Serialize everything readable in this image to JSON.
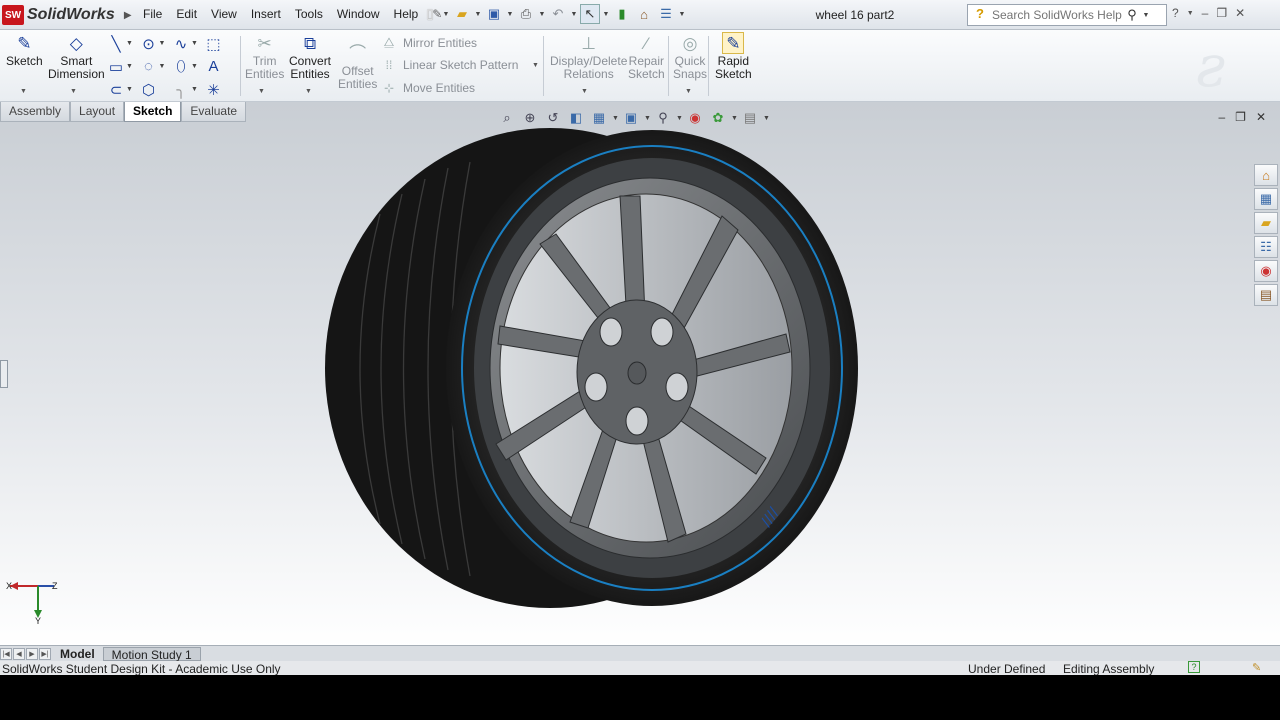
{
  "app": {
    "brand": "SolidWorks",
    "badge": "SW",
    "doc_title": "wheel 16 part2"
  },
  "menu": [
    "File",
    "Edit",
    "View",
    "Insert",
    "Tools",
    "Window",
    "Help"
  ],
  "search": {
    "placeholder": "Search SolidWorks Help"
  },
  "ribbon": {
    "sketch": "Sketch",
    "smart_dimension_1": "Smart",
    "smart_dimension_2": "Dimension",
    "trim_1": "Trim",
    "trim_2": "Entities",
    "convert_1": "Convert",
    "convert_2": "Entities",
    "offset_1": "Offset",
    "offset_2": "Entities",
    "mirror": "Mirror Entities",
    "linear_pattern": "Linear Sketch Pattern",
    "move": "Move Entities",
    "display_delete_1": "Display/Delete",
    "display_delete_2": "Relations",
    "repair_1": "Repair",
    "repair_2": "Sketch",
    "quick_snaps_1": "Quick",
    "quick_snaps_2": "Snaps",
    "rapid_1": "Rapid",
    "rapid_2": "Sketch"
  },
  "command_tabs": [
    "Assembly",
    "Layout",
    "Sketch",
    "Evaluate"
  ],
  "active_command_tab": "Sketch",
  "triad": {
    "x": "X",
    "y": "Y",
    "z": "Z"
  },
  "bottom_tabs": [
    "Model",
    "Motion Study 1"
  ],
  "status": {
    "left": "SolidWorks Student Design Kit - Academic Use Only",
    "sketch_state": "Under Defined",
    "mode": "Editing Assembly",
    "help": "?"
  },
  "colors": {
    "accent": "#1a7fc2",
    "brand": "#c8161d",
    "tire": "#1b1b1b",
    "rim": "#5a5d60"
  }
}
